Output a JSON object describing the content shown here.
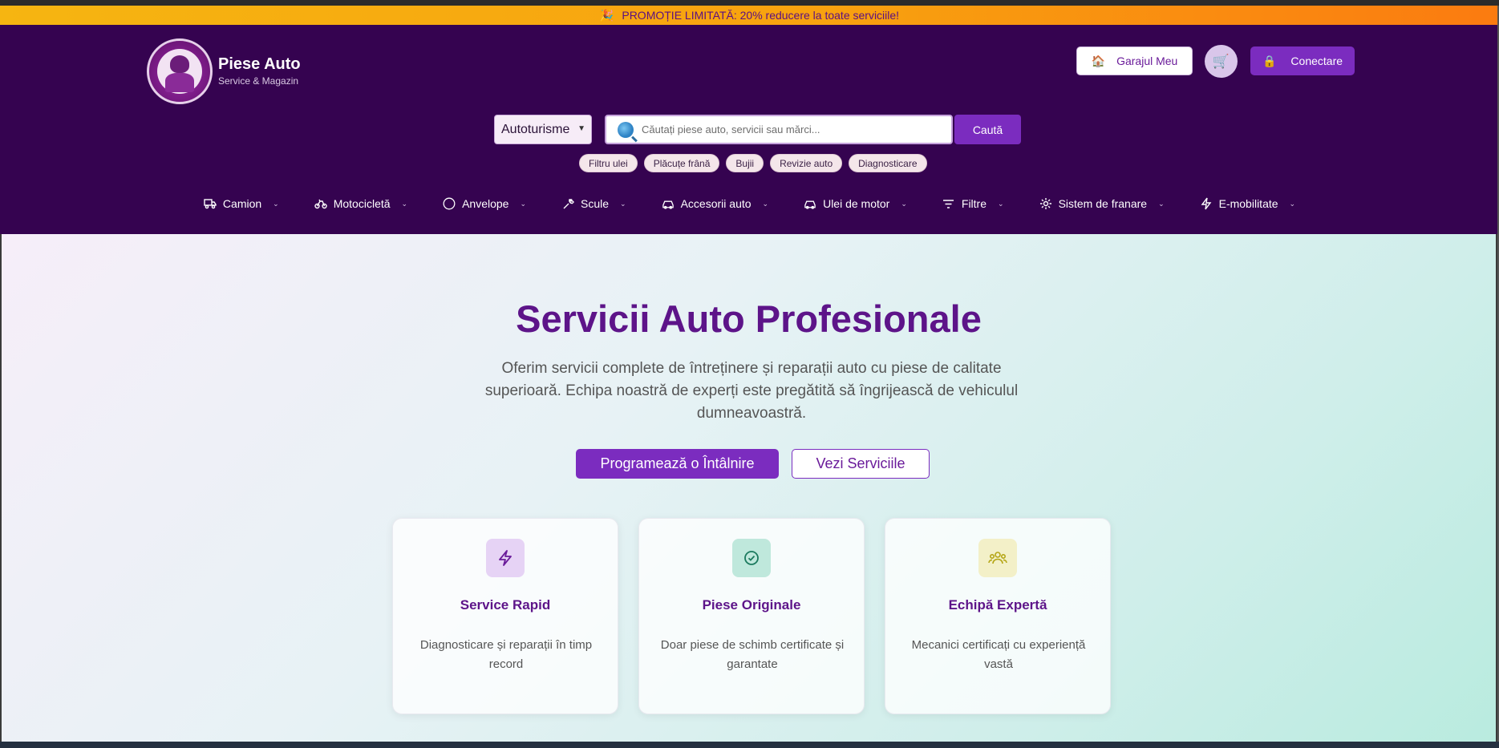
{
  "promo": {
    "icon": "party-popper-icon",
    "text": "PROMOȚIE LIMITATĂ: 20% reducere la toate serviciile!"
  },
  "brand": {
    "title": "Piese Auto",
    "subtitle": "Service & Magazin"
  },
  "header_actions": {
    "garage_label": "Garajul Meu",
    "garage_icon": "house-icon",
    "cart_icon": "cart-icon",
    "login_label": "Conectare",
    "login_icon": "lock-icon"
  },
  "search": {
    "vehicle_type": "Autoturisme",
    "placeholder": "Căutați piese auto, servicii sau mărci...",
    "button": "Caută",
    "chips": [
      "Filtru ulei",
      "Plăcuțe frână",
      "Bujii",
      "Revizie auto",
      "Diagnosticare"
    ]
  },
  "nav": [
    {
      "label": "Camion",
      "icon": "truck-icon"
    },
    {
      "label": "Motocicletă",
      "icon": "bike-icon"
    },
    {
      "label": "Anvelope",
      "icon": "circle-icon"
    },
    {
      "label": "Scule",
      "icon": "wrench-icon"
    },
    {
      "label": "Accesorii auto",
      "icon": "car-icon"
    },
    {
      "label": "Ulei de motor",
      "icon": "car-icon"
    },
    {
      "label": "Filtre",
      "icon": "filter-icon"
    },
    {
      "label": "Sistem de franare",
      "icon": "gear-icon"
    },
    {
      "label": "E-mobilitate",
      "icon": "lightning-icon"
    }
  ],
  "hero": {
    "title": "Servicii Auto Profesionale",
    "text": "Oferim servicii complete de întreținere și reparații auto cu piese de calitate superioară. Echipa noastră de experți este pregătită să îngrijească de vehiculul dumneavoastră.",
    "primary_button": "Programează o Întâlnire",
    "secondary_button": "Vezi Serviciile"
  },
  "features": [
    {
      "title": "Service Rapid",
      "text": "Diagnosticare și reparații în timp record",
      "icon": "lightning-icon",
      "color": "#e6d3f5"
    },
    {
      "title": "Piese Originale",
      "text": "Doar piese de schimb certificate și garantate",
      "icon": "check-circle-icon",
      "color": "#bfe8dc"
    },
    {
      "title": "Echipă Expertă",
      "text": "Mecanici certificați cu experiență vastă",
      "icon": "team-icon",
      "color": "#f3f0c8"
    }
  ]
}
